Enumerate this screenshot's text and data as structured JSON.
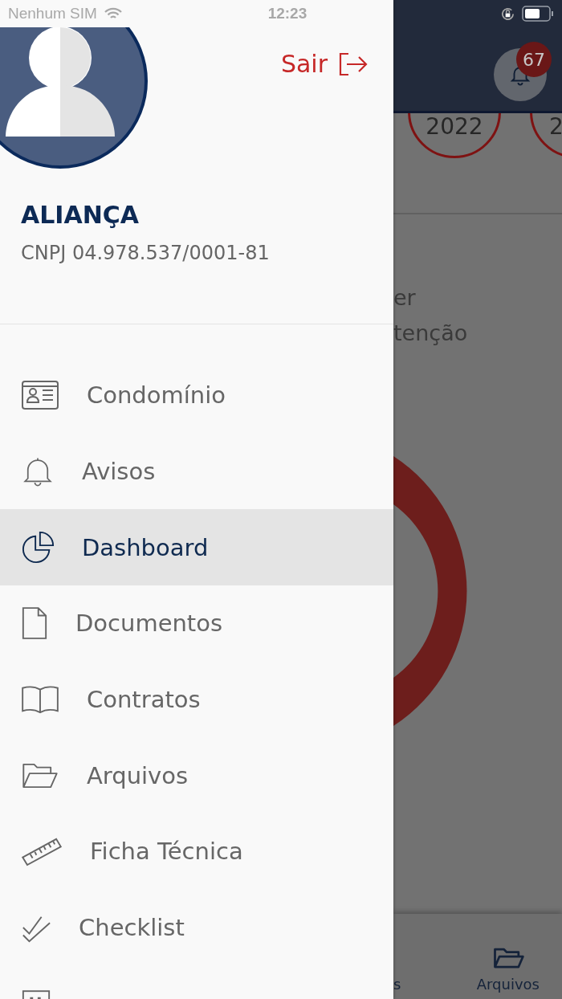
{
  "status_bar": {
    "carrier": "Nenhum SIM",
    "time": "12:23"
  },
  "drawer": {
    "logout": "Sair",
    "name": "ALIANÇA",
    "cnpj": "CNPJ 04.978.537/0001-81",
    "menu": [
      {
        "label": "Condomínio",
        "kind": "id-card",
        "selected": false
      },
      {
        "label": "Avisos",
        "kind": "bell",
        "selected": false
      },
      {
        "label": "Dashboard",
        "kind": "pie",
        "selected": true
      },
      {
        "label": "Documentos",
        "kind": "document",
        "selected": false
      },
      {
        "label": "Contratos",
        "kind": "book",
        "selected": false
      },
      {
        "label": "Arquivos",
        "kind": "folder",
        "selected": false
      },
      {
        "label": "Ficha Técnica",
        "kind": "ruler",
        "selected": false
      },
      {
        "label": "Checklist",
        "kind": "check",
        "selected": false
      },
      {
        "kind": "building",
        "selected": false
      }
    ]
  },
  "background": {
    "notification_count": "67",
    "years": [
      "2022",
      "2"
    ],
    "text_lines": [
      "er",
      "tenção"
    ],
    "tab_bar": [
      {
        "label": "s"
      },
      {
        "label": "Arquivos",
        "kind": "folder"
      }
    ]
  }
}
